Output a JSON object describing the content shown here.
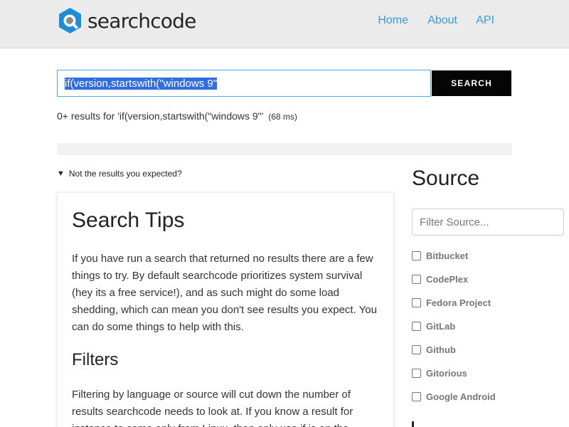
{
  "header": {
    "brand": "searchcode",
    "logo_icon": "magnifier-hexagon-icon",
    "nav": {
      "home": "Home",
      "about": "About",
      "api": "API"
    },
    "colors": {
      "logo_blue": "#1b8ed8",
      "nav_link": "#3a9ad9",
      "header_bg": "#ebebeb"
    }
  },
  "search": {
    "query": "if(version,startswith(\"windows 9\"",
    "button_label": "SEARCH",
    "query_selected": true
  },
  "results": {
    "summary": "0+ results for 'if(version,startswith(\"windows 9\"'",
    "time": "(68 ms)"
  },
  "toggle": {
    "label": "Not the results you expected?",
    "icon": "caret-down-icon",
    "expanded": true
  },
  "tips": {
    "title": "Search Tips",
    "intro": "If you have run a search that returned no results there are a few things to try. By default searchcode prioritizes system survival (hey its a free service!), and as such might do some load shedding, which can mean you don't see results you expect. You can do some things to help with this.",
    "filters_title": "Filters",
    "filters_text": "Filtering by language or source will cut down the number of results searchcode needs to look at. If you know a result for instance to come only from Linux, then only use if is on the"
  },
  "source": {
    "title": "Source",
    "filter_placeholder": "Filter Source...",
    "items": [
      {
        "label": "Bitbucket",
        "checked": false
      },
      {
        "label": "CodePlex",
        "checked": false
      },
      {
        "label": "Fedora Project",
        "checked": false
      },
      {
        "label": "GitLab",
        "checked": false
      },
      {
        "label": "Github",
        "checked": false
      },
      {
        "label": "Gitorious",
        "checked": false
      },
      {
        "label": "Google Android",
        "checked": false
      }
    ]
  }
}
